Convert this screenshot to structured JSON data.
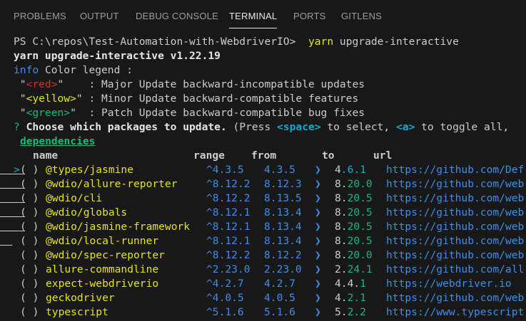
{
  "tabs": [
    {
      "label": "PROBLEMS",
      "active": false
    },
    {
      "label": "OUTPUT",
      "active": false
    },
    {
      "label": "DEBUG CONSOLE",
      "active": false
    },
    {
      "label": "TERMINAL",
      "active": true
    },
    {
      "label": "PORTS",
      "active": false
    },
    {
      "label": "GITLENS",
      "active": false
    }
  ],
  "terminal": {
    "prompt": "PS C:\\repos\\Test-Automation-with-WebdriverIO>",
    "command": "yarn upgrade-interactive",
    "version_line": "yarn upgrade-interactive v1.22.19",
    "info_tag": "info",
    "info_text": " Color legend :",
    "legend": [
      {
        "open": " \"",
        "tag": "<red>",
        "close": "\"    ",
        "text": ": Major Update backward-incompatible updates",
        "color": "#cd3131"
      },
      {
        "open": " \"",
        "tag": "<yellow>",
        "close": "\" ",
        "text": ": Minor Update backward-compatible features",
        "color": "#e5e510"
      },
      {
        "open": " \"",
        "tag": "<green>",
        "close": "\"  ",
        "text": ": Patch Update backward-compatible bug fixes",
        "color": "#0dbc79"
      }
    ],
    "question_mark": "?",
    "question": " Choose which packages to update.",
    "hint_open": " (Press ",
    "hint_space": "<space>",
    "hint_mid": " to select, ",
    "hint_a": "<a>",
    "hint_end": " to toggle all,",
    "group": "dependencies",
    "headers": {
      "name": "name",
      "range": "range",
      "from": "from",
      "to": "to",
      "url": "url"
    },
    "packages": [
      {
        "cursor": ">",
        "check": "( )",
        "name": "@types/jasmine",
        "range": "^4.3.5",
        "from": "4.3.5",
        "arrow": "❯",
        "to_head": "4",
        "to_tail": ".6.1",
        "to_color": "#11a8cd",
        "url": "https://github.com/Def",
        "name_color": "#e5e510"
      },
      {
        "cursor": " ",
        "check": "( )",
        "name": "@wdio/allure-reporter",
        "range": "^8.12.2",
        "from": "8.12.3",
        "arrow": "❯",
        "to_head": "8.",
        "to_tail": "20.0",
        "to_color": "#0dbc79",
        "url": "https://github.com/web",
        "name_color": "#e5e510"
      },
      {
        "cursor": " ",
        "check": "( )",
        "name": "@wdio/cli",
        "range": "^8.12.2",
        "from": "8.13.5",
        "arrow": "❯",
        "to_head": "8.",
        "to_tail": "20.5",
        "to_color": "#0dbc79",
        "url": "https://github.com/web",
        "name_color": "#e5e510"
      },
      {
        "cursor": " ",
        "check": "( )",
        "name": "@wdio/globals",
        "range": "^8.12.1",
        "from": "8.13.4",
        "arrow": "❯",
        "to_head": "8.",
        "to_tail": "20.5",
        "to_color": "#0dbc79",
        "url": "https://github.com/web",
        "name_color": "#e5e510"
      },
      {
        "cursor": " ",
        "check": "( )",
        "name": "@wdio/jasmine-framework",
        "range": "^8.12.1",
        "from": "8.13.4",
        "arrow": "❯",
        "to_head": "8.",
        "to_tail": "20.5",
        "to_color": "#0dbc79",
        "url": "https://github.com/web",
        "name_color": "#e5e510"
      },
      {
        "cursor": " ",
        "check": "( )",
        "name": "@wdio/local-runner",
        "range": "^8.12.1",
        "from": "8.13.4",
        "arrow": "❯",
        "to_head": "8.",
        "to_tail": "20.5",
        "to_color": "#0dbc79",
        "url": "https://github.com/web",
        "name_color": "#e5e510"
      },
      {
        "cursor": " ",
        "check": "( )",
        "name": "@wdio/spec-reporter",
        "range": "^8.12.2",
        "from": "8.12.2",
        "arrow": "❯",
        "to_head": "8.",
        "to_tail": "20.0",
        "to_color": "#0dbc79",
        "url": "https://github.com/web",
        "name_color": "#e5e510"
      },
      {
        "cursor": " ",
        "check": "( )",
        "name": "allure-commandline",
        "range": "^2.23.0",
        "from": "2.23.0",
        "arrow": "❯",
        "to_head": "2.",
        "to_tail": "24.1",
        "to_color": "#0dbc79",
        "url": "https://github.com/all",
        "name_color": "#e5e510"
      },
      {
        "cursor": " ",
        "check": "( )",
        "name": "expect-webdriverio",
        "range": "^4.2.7",
        "from": "4.2.7",
        "arrow": "❯",
        "to_head": "4.4.",
        "to_tail": "1",
        "to_color": "#0dbc79",
        "url": "https://webdriver.io",
        "name_color": "#e5e510"
      },
      {
        "cursor": " ",
        "check": "( )",
        "name": "geckodriver",
        "range": "^4.0.5",
        "from": "4.0.5",
        "arrow": "❯",
        "to_head": "4.",
        "to_tail": "2.1",
        "to_color": "#0dbc79",
        "url": "https://github.com/web",
        "name_color": "#e5e510"
      },
      {
        "cursor": " ",
        "check": "( )",
        "name": "typescript",
        "range": "^5.1.6",
        "from": "5.1.6",
        "arrow": "❯",
        "to_head": "5.",
        "to_tail": "2.2",
        "to_color": "#0dbc79",
        "url": "https://www.typescript",
        "name_color": "#e5e510"
      }
    ]
  }
}
